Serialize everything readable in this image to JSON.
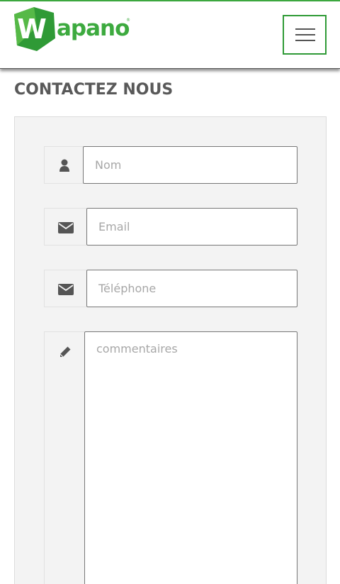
{
  "header": {
    "logo_text": "apano",
    "logo_letter": "W",
    "logo_reg": "®",
    "brand_color": "#3daa3f",
    "menu_icon": "hamburger-menu-icon"
  },
  "page": {
    "title": "CONTACTEZ NOUS"
  },
  "form": {
    "name": {
      "icon": "user-icon",
      "placeholder": "Nom",
      "value": ""
    },
    "email": {
      "icon": "envelope-icon",
      "placeholder": "Email",
      "value": ""
    },
    "phone": {
      "icon": "envelope-icon",
      "placeholder": "Téléphone",
      "value": ""
    },
    "comments": {
      "icon": "pencil-icon",
      "placeholder": "commentaires",
      "value": ""
    }
  }
}
